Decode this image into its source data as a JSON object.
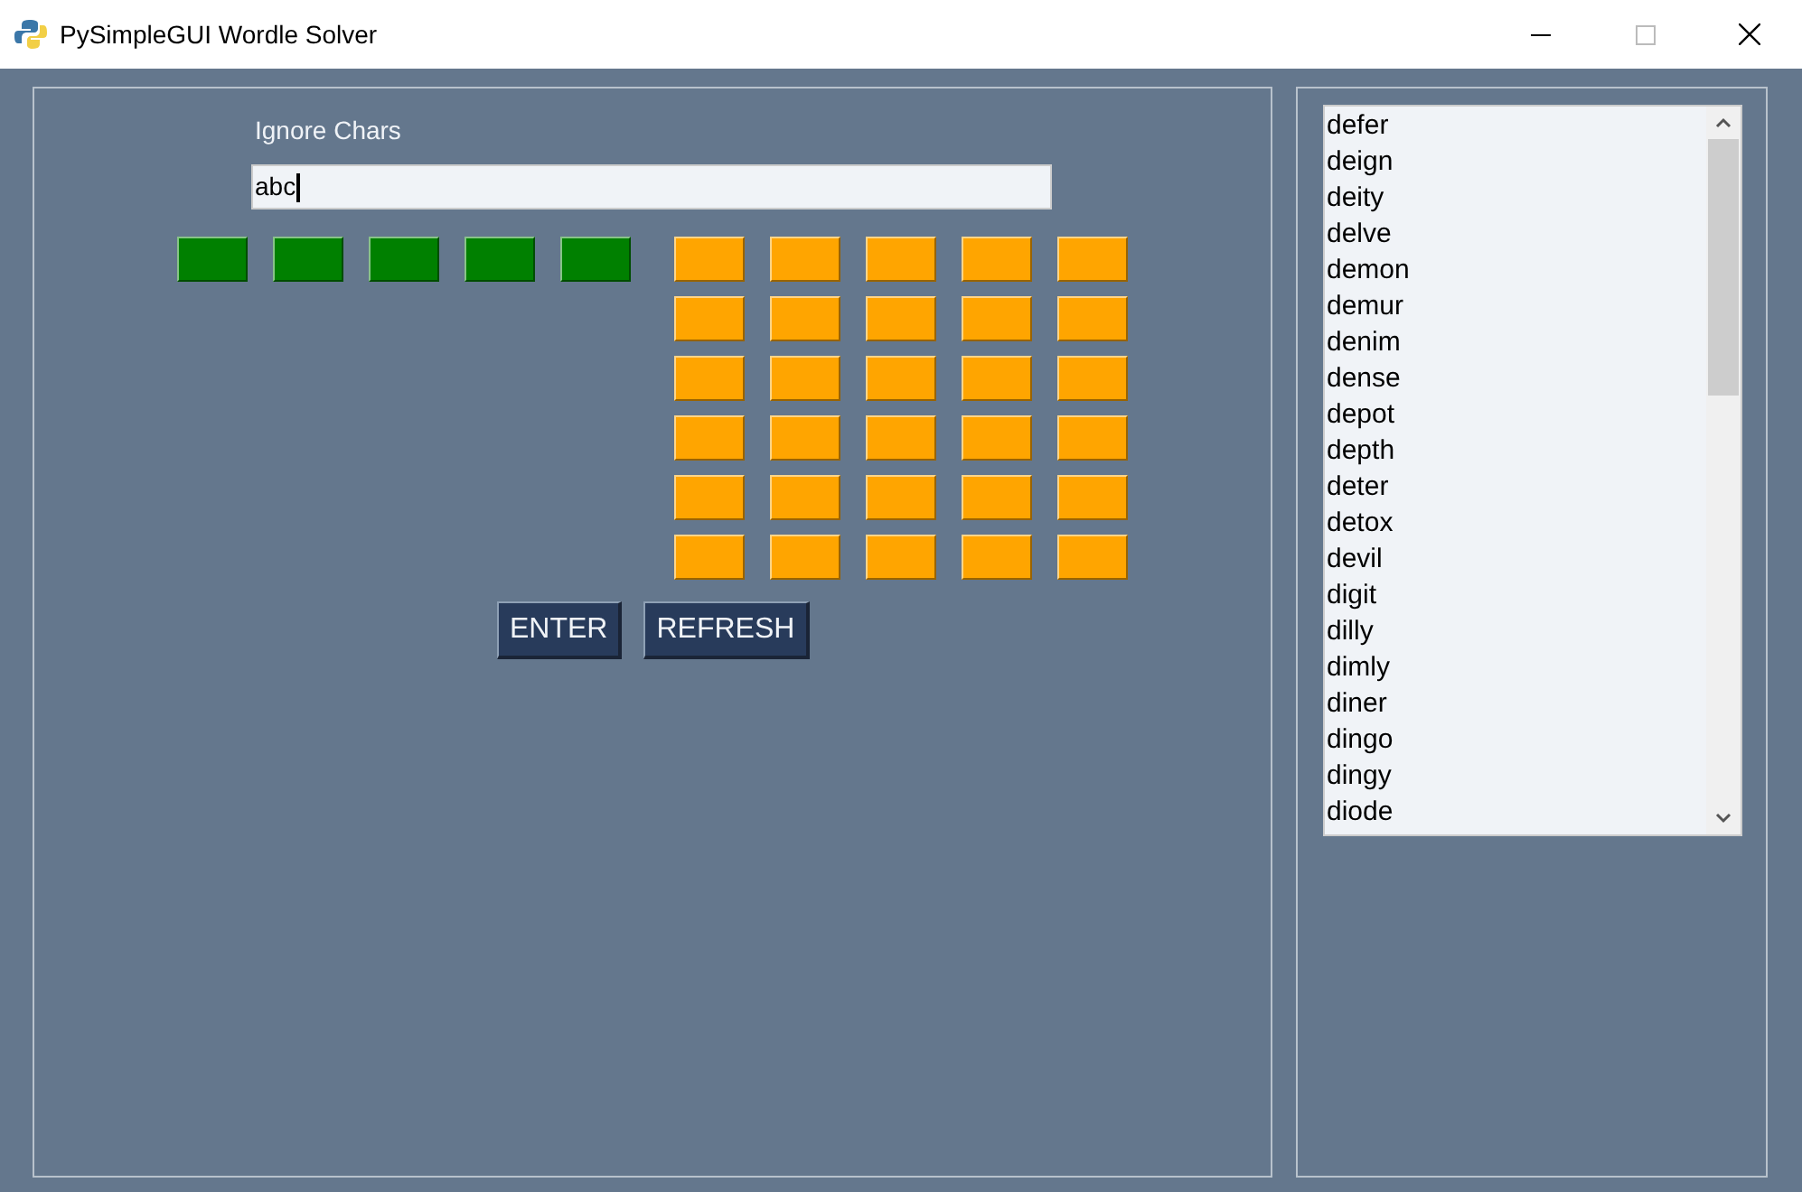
{
  "window": {
    "title": "PySimpleGUI Wordle Solver"
  },
  "ignore": {
    "label": "Ignore Chars",
    "value": "abc"
  },
  "placed_letters": [
    {
      "color": "#008000"
    },
    {
      "color": "#008000"
    },
    {
      "color": "#008000"
    },
    {
      "color": "#008000"
    },
    {
      "color": "#008000"
    }
  ],
  "present_letters": [
    [
      {
        "color": "#ffa500"
      },
      {
        "color": "#ffa500"
      },
      {
        "color": "#ffa500"
      },
      {
        "color": "#ffa500"
      },
      {
        "color": "#ffa500"
      }
    ],
    [
      {
        "color": "#ffa500"
      },
      {
        "color": "#ffa500"
      },
      {
        "color": "#ffa500"
      },
      {
        "color": "#ffa500"
      },
      {
        "color": "#ffa500"
      }
    ],
    [
      {
        "color": "#ffa500"
      },
      {
        "color": "#ffa500"
      },
      {
        "color": "#ffa500"
      },
      {
        "color": "#ffa500"
      },
      {
        "color": "#ffa500"
      }
    ],
    [
      {
        "color": "#ffa500"
      },
      {
        "color": "#ffa500"
      },
      {
        "color": "#ffa500"
      },
      {
        "color": "#ffa500"
      },
      {
        "color": "#ffa500"
      }
    ],
    [
      {
        "color": "#ffa500"
      },
      {
        "color": "#ffa500"
      },
      {
        "color": "#ffa500"
      },
      {
        "color": "#ffa500"
      },
      {
        "color": "#ffa500"
      }
    ],
    [
      {
        "color": "#ffa500"
      },
      {
        "color": "#ffa500"
      },
      {
        "color": "#ffa500"
      },
      {
        "color": "#ffa500"
      },
      {
        "color": "#ffa500"
      }
    ]
  ],
  "buttons": [
    "ENTER",
    "REFRESH"
  ],
  "words": [
    "defer",
    "deign",
    "deity",
    "delve",
    "demon",
    "demur",
    "denim",
    "dense",
    "depot",
    "depth",
    "deter",
    "detox",
    "devil",
    "digit",
    "dilly",
    "dimly",
    "diner",
    "dingo",
    "dingy",
    "diode"
  ]
}
